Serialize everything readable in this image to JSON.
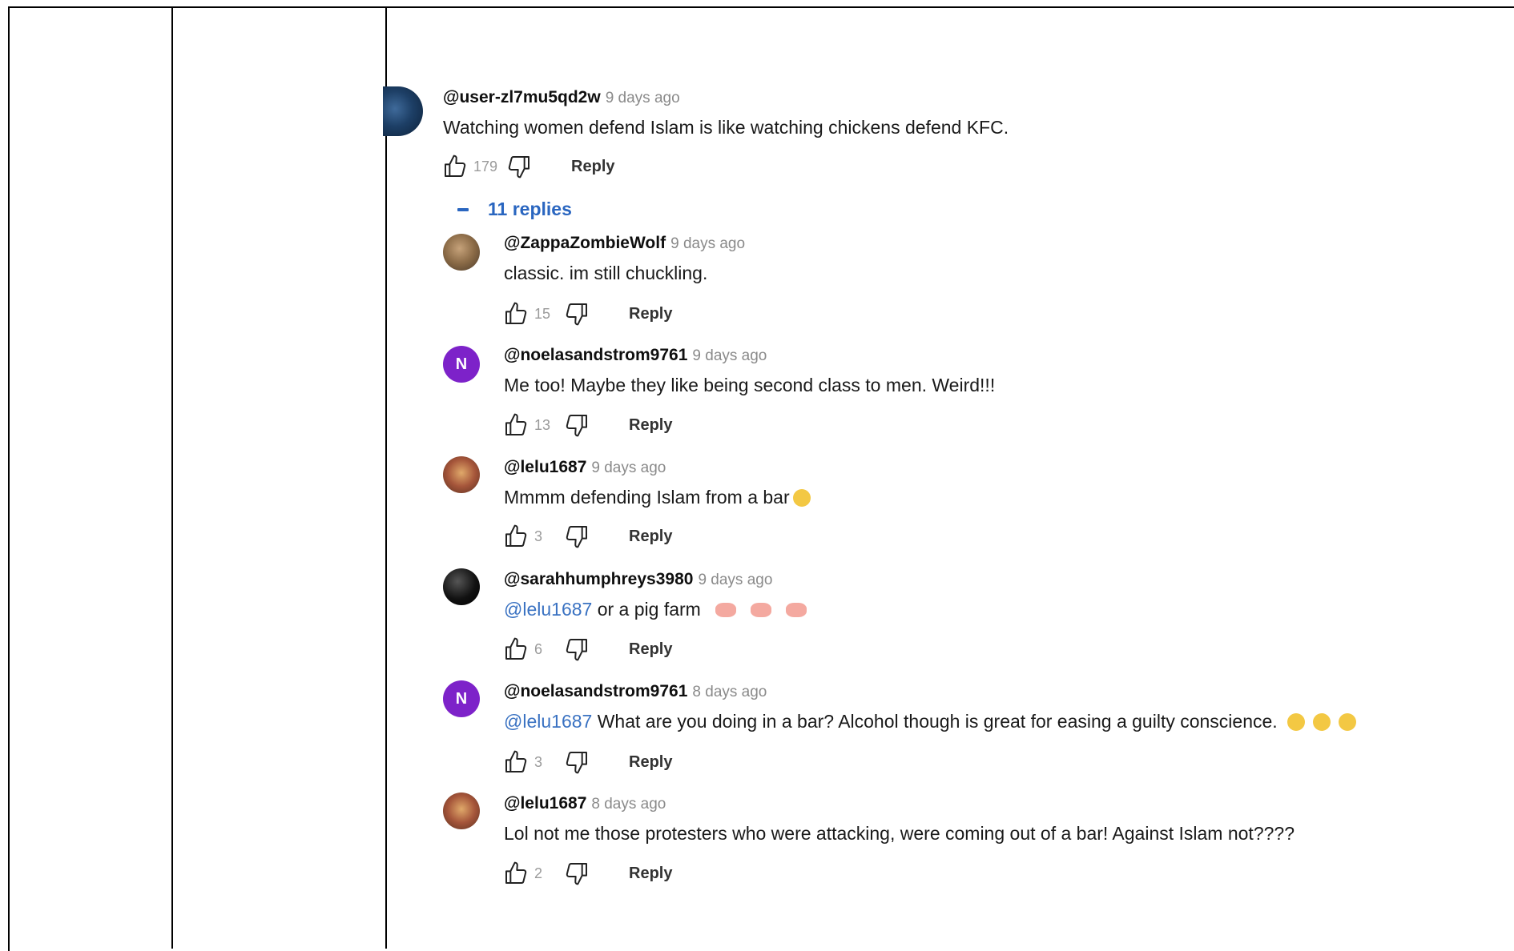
{
  "thread": {
    "comment": {
      "handle": "@user-zl7mu5qd2w",
      "time": "9 days ago",
      "text": "Watching women defend Islam is like watching chickens defend KFC.",
      "likes": "179",
      "reply_label": "Reply"
    },
    "replies_toggle": "11 replies",
    "replies": [
      {
        "handle": "@ZappaZombieWolf",
        "time": "9 days ago",
        "avatar": "",
        "text": "classic. im still chuckling.",
        "mention": "",
        "likes": "15",
        "reply_label": "Reply"
      },
      {
        "handle": "@noelasandstrom9761",
        "time": "9 days ago",
        "avatar": "N",
        "text": "Me too! Maybe they like being second class to men.  Weird!!!",
        "mention": "",
        "likes": "13",
        "reply_label": "Reply"
      },
      {
        "handle": "@lelu1687",
        "time": "9 days ago",
        "avatar": "",
        "text": "Mmmm defending Islam from a bar",
        "mention": "",
        "likes": "3",
        "reply_label": "Reply"
      },
      {
        "handle": "@sarahhumphreys3980",
        "time": "9 days ago",
        "avatar": "",
        "text": " or a pig farm",
        "mention": "@lelu1687",
        "likes": "6",
        "reply_label": "Reply"
      },
      {
        "handle": "@noelasandstrom9761",
        "time": "8 days ago",
        "avatar": "N",
        "text": "  What are you doing in a bar? Alcohol though is great for easing a guilty conscience.",
        "mention": "@lelu1687",
        "likes": "3",
        "reply_label": "Reply"
      },
      {
        "handle": "@lelu1687",
        "time": "8 days ago",
        "avatar": "",
        "text": "Lol not me those protesters who were attacking, were coming out of a bar! Against Islam not????",
        "mention": "",
        "likes": "2",
        "reply_label": "Reply"
      }
    ]
  },
  "icons": {
    "like": "thumbs-up-icon",
    "dislike": "thumbs-down-icon",
    "collapse": "caret-up-icon"
  },
  "colors": {
    "link": "#2a66c0",
    "avatar_n": "#7d22c9",
    "muted": "#8a8a8a"
  }
}
